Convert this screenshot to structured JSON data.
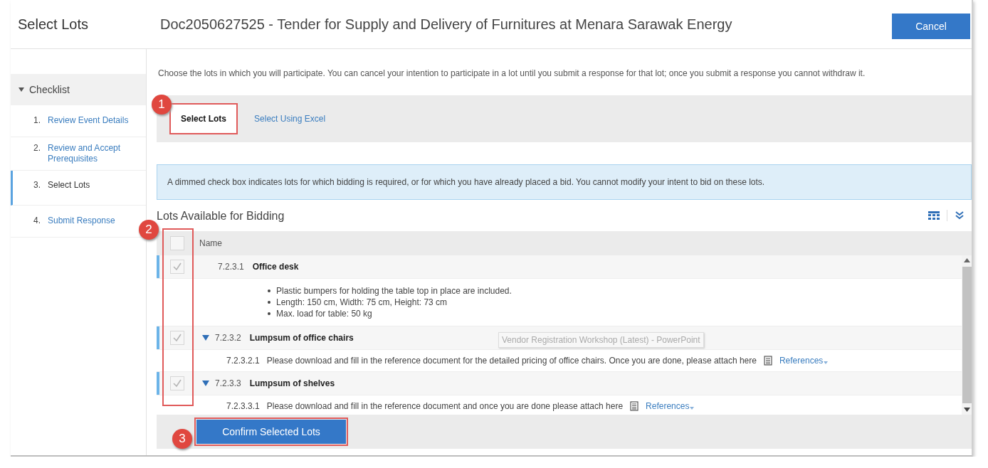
{
  "header": {
    "title": "Select Lots",
    "doc_title": "Doc2050627525 - Tender for Supply and Delivery of Furnitures at Menara Sarawak Energy",
    "cancel": "Cancel"
  },
  "checklist": {
    "title": "Checklist",
    "expanded": true,
    "items": [
      {
        "number": "1.",
        "label": "Review Event Details",
        "selected": false
      },
      {
        "number": "2.",
        "label": "Review and Accept Prerequisites",
        "selected": false
      },
      {
        "number": "3.",
        "label": "Select Lots",
        "selected": true
      },
      {
        "number": "4.",
        "label": "Submit Response",
        "selected": false
      }
    ]
  },
  "intro": "Choose the lots in which you will participate.  You can cancel your intention to participate in a lot until you submit a response for that lot;  once you submit a response you cannot withdraw it.",
  "tabs": [
    {
      "label": "Select Lots",
      "selected": true
    },
    {
      "label": "Select Using Excel",
      "selected": false
    }
  ],
  "info": "A dimmed check box indicates lots for which bidding is required, or for which you have already placed a bid. You cannot modify your intent to bid on these lots.",
  "section_title": "Lots Available for Bidding",
  "table": {
    "columns": [
      "Name"
    ],
    "header_checked": false,
    "rows": [
      {
        "kind": "lot",
        "number": "7.2.3.1",
        "name": "Office desk",
        "checked": true,
        "disabled": true,
        "children": [
          {
            "kind": "bullets",
            "items": [
              "Plastic bumpers for holding the table top in place are included.",
              "Length: 150 cm, Width: 75 cm, Height: 73 cm",
              "Max. load for table: 50 kg"
            ]
          }
        ]
      },
      {
        "kind": "lot",
        "number": "7.2.3.2",
        "name": "Lumpsum of office chairs",
        "checked": true,
        "disabled": true,
        "expanded": true,
        "children": [
          {
            "kind": "line",
            "number": "7.2.3.2.1",
            "text": "Please download and fill in the reference document for the detailed pricing of office chairs. Once you are done, please attach here",
            "link": "References"
          }
        ]
      },
      {
        "kind": "lot",
        "number": "7.2.3.3",
        "name": "Lumpsum of shelves",
        "checked": true,
        "disabled": true,
        "expanded": true,
        "children": [
          {
            "kind": "line",
            "number": "7.2.3.3.1",
            "text": "Please download and fill in the reference document and once you are done please attach here",
            "link": "References"
          }
        ]
      }
    ]
  },
  "confirm": "Confirm Selected Lots",
  "callouts": [
    "1",
    "2",
    "3"
  ],
  "tooltip": "Vendor Registration Workshop (Latest) - PowerPoint"
}
